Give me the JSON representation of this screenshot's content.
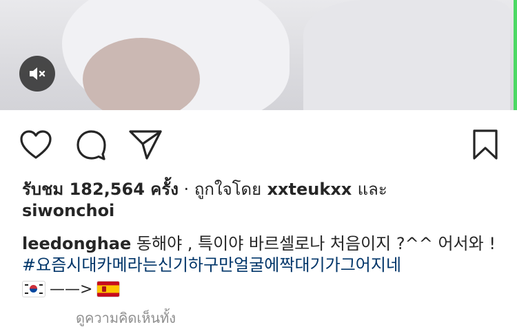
{
  "video": {
    "mute_icon": "speaker-muted-icon",
    "colors": {
      "side_edge": "#4cd964",
      "mute_bg": "#262626"
    }
  },
  "actions": {
    "like_icon": "heart-icon",
    "comment_icon": "comment-icon",
    "share_icon": "send-icon",
    "save_icon": "bookmark-icon"
  },
  "meta": {
    "views_label": "รับชม 182,564 ครั้ง",
    "separator": " · ",
    "liked_by_prefix": "ถูกใจโดย",
    "liked_user": "xxteukxx",
    "and_label": "และ",
    "second_user": "siwonchoi"
  },
  "caption": {
    "username": "leedonghae",
    "text": " 동해야 , 특이야 바르셀로나 처음이지 ?^^ 어서와 ! ",
    "hashtag": "#요즘시대카메라는신기하구만얼굴에짝대기가그어지네",
    "arrow": "——>",
    "flag_left": "korea-flag-icon",
    "flag_right": "spain-flag-icon"
  },
  "footer": {
    "partial_text": "ดูความคิดเห็นทั้ง"
  },
  "colors": {
    "text": "#262626",
    "hashtag": "#003569",
    "muted": "#8e8e8e"
  }
}
